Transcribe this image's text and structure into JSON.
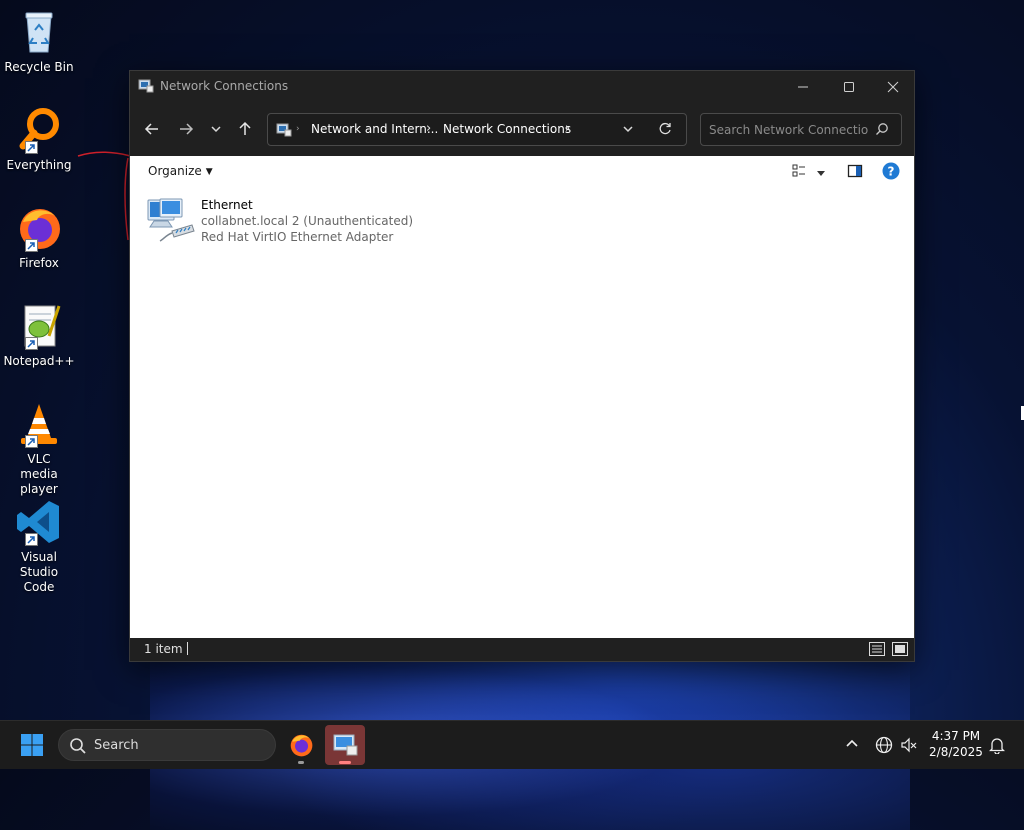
{
  "desktop": {
    "icons": [
      {
        "label": "Recycle Bin"
      },
      {
        "label": "Everything"
      },
      {
        "label": "Firefox"
      },
      {
        "label": "Notepad++"
      },
      {
        "label": "VLC media player"
      },
      {
        "label": "Visual Studio Code"
      }
    ]
  },
  "window": {
    "title": "Network Connections",
    "address": {
      "crumbs": [
        "Network and Intern...",
        "Network Connections"
      ],
      "separator": "›"
    },
    "search": {
      "placeholder": "Search Network Connections"
    },
    "toolbar": {
      "organize_label": "Organize"
    },
    "items": [
      {
        "name": "Ethernet",
        "status": "collabnet.local 2 (Unauthenticated)",
        "device": "Red Hat VirtIO Ethernet Adapter"
      }
    ],
    "status": {
      "count": "1 item"
    }
  },
  "taskbar": {
    "search_label": "Search",
    "time": "4:37 PM",
    "date": "2/8/2025"
  },
  "icons": {
    "back": "arrow-left-icon",
    "forward": "arrow-right-icon",
    "recent": "chevron-down-icon",
    "up": "arrow-up-icon",
    "refresh": "refresh-icon",
    "search": "search-icon",
    "help": "help-icon"
  },
  "colors": {
    "titlebar": "#202020",
    "accent": "#0a66c2",
    "taskbar": "#1c1c1c",
    "active_app": "#7a3636"
  }
}
